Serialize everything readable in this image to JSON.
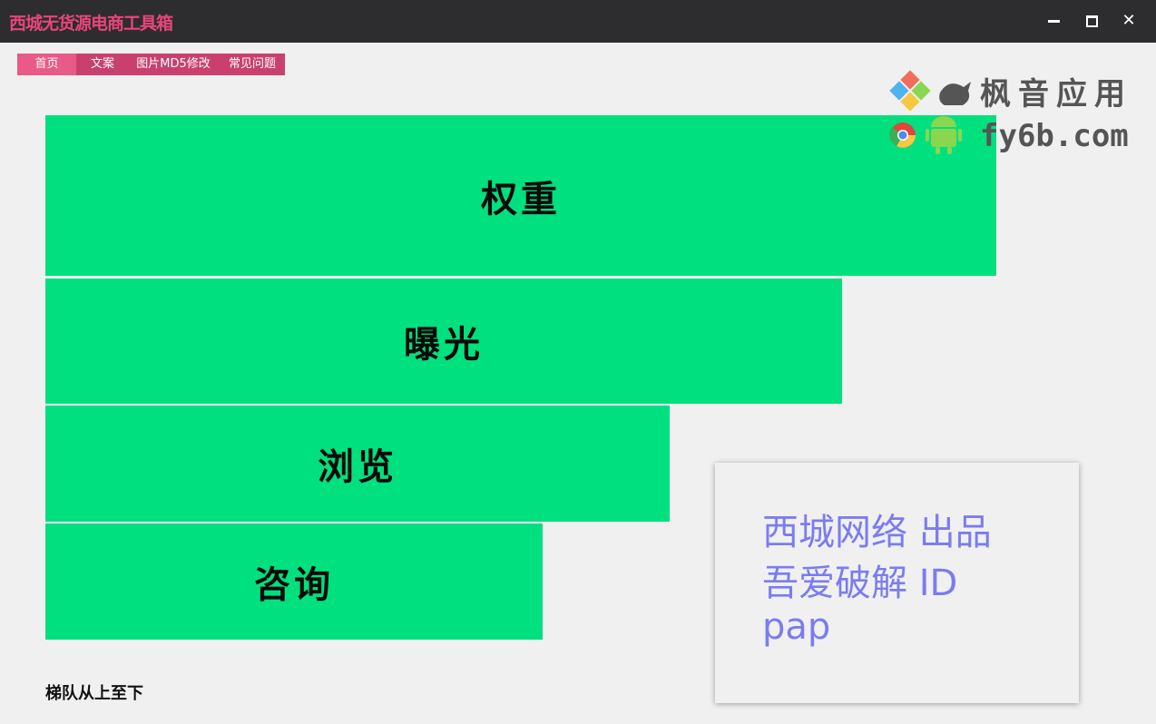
{
  "window": {
    "title": "西城无货源电商工具箱",
    "minimize_icon": "minimize-icon",
    "maximize_icon": "maximize-icon",
    "close_icon": "close-icon",
    "close_label": "✕"
  },
  "menu": {
    "items": [
      {
        "label": "首页",
        "active": true
      },
      {
        "label": "文案"
      },
      {
        "label": "图片MD5修改"
      },
      {
        "label": "常见问题"
      }
    ]
  },
  "ladder": {
    "bars": [
      {
        "label": "权重"
      },
      {
        "label": "曝光"
      },
      {
        "label": "浏览"
      },
      {
        "label": "咨询"
      }
    ],
    "footer": "梯队从上至下",
    "bar_color": "#00e07e"
  },
  "credits": {
    "line1": "西城网络  出品",
    "line2": "吾爱破解 ID",
    "line3": "pap",
    "color": "#7b7cf0"
  },
  "watermark": {
    "text1": "枫音应用",
    "text2": "fy6b.com"
  },
  "colors": {
    "title_bar": "#2d2d30",
    "brand_pink": "#e8457a",
    "menu_bg": "#c9406f",
    "menu_active": "#e85a87"
  }
}
